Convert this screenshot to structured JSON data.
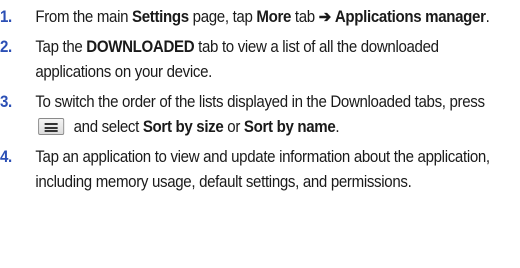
{
  "steps": [
    {
      "number": "1.",
      "parts": [
        "From the main ",
        "Settings",
        " page, tap ",
        "More",
        " tab ",
        "➔",
        " ",
        "Applications manager",
        "."
      ]
    },
    {
      "number": "2.",
      "parts": [
        "Tap the ",
        "DOWNLOADED",
        " tab to view a list of all the downloaded applications on your device."
      ]
    },
    {
      "number": "3.",
      "parts": [
        "To switch the order of the lists displayed in the Downloaded tabs, press",
        " and select ",
        "Sort by size",
        " or ",
        "Sort by name",
        "."
      ],
      "icon": "menu-key-icon"
    },
    {
      "number": "4.",
      "parts": [
        "Tap an application to view and update information about the application, including memory usage, default settings, and permissions."
      ]
    }
  ],
  "colors": {
    "step_number": "#2b4fb5",
    "text": "#1a1a1a"
  }
}
